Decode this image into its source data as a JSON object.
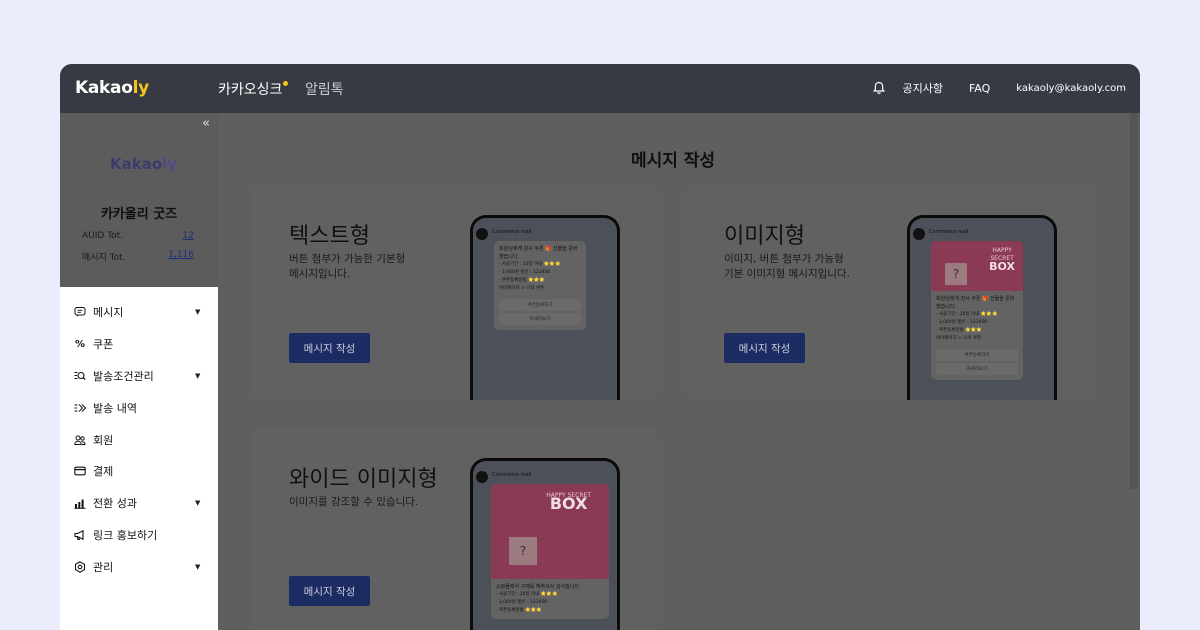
{
  "topbar": {
    "logo_main": "Kakao",
    "logo_accent": "ly",
    "tabs": [
      "카카오싱크",
      "알림톡"
    ],
    "notice": "공지사항",
    "faq": "FAQ",
    "email": "kakaoly@kakaoly.com"
  },
  "sidebar": {
    "collapse_glyph": "«",
    "logo_a": "Kakao",
    "logo_b": "ly",
    "store_name": "카카올리 굿즈",
    "stats": [
      {
        "label": "AUID Tot.",
        "value": "12"
      },
      {
        "label": "메시지 Tot.",
        "value": "1,116"
      }
    ],
    "menu": [
      {
        "label": "메시지",
        "icon": "message-icon",
        "has_caret": true
      },
      {
        "label": "쿠폰",
        "icon": "percent-icon",
        "has_caret": false
      },
      {
        "label": "발송조건관리",
        "icon": "search-list-icon",
        "has_caret": true
      },
      {
        "label": "발송 내역",
        "icon": "send-history-icon",
        "has_caret": false
      },
      {
        "label": "회원",
        "icon": "users-icon",
        "has_caret": false
      },
      {
        "label": "결제",
        "icon": "card-icon",
        "has_caret": false
      },
      {
        "label": "전환 성과",
        "icon": "chart-icon",
        "has_caret": true
      },
      {
        "label": "링크 홍보하기",
        "icon": "megaphone-icon",
        "has_caret": false
      },
      {
        "label": "관리",
        "icon": "settings-icon",
        "has_caret": true
      }
    ]
  },
  "main": {
    "title": "메시지 작성",
    "cards": [
      {
        "title": "텍스트형",
        "desc_1": "버튼 첨부가 가능한 기본형",
        "desc_2": "메시지입니다.",
        "button": "메시지 작성"
      },
      {
        "title": "이미지형",
        "desc_1": "이미지, 버튼 첨부가 가능형",
        "desc_2": "기본 이미지형 메시지입니다.",
        "button": "메시지 작성"
      },
      {
        "title": "와이드 이미지형",
        "desc_1": "이미지를 강조할 수 있습니다.",
        "desc_2": "",
        "button": "메시지 작성"
      }
    ],
    "phone": {
      "label": "Commerce mall",
      "brand": "kakao",
      "text_intro": "회원님에게 감사 쿠폰 🎁 선물을 준비했습니다.",
      "line1": "· 사용기간 : 10일 이내 ⭐⭐⭐",
      "line2": "· 3,000원 할인 : 123456",
      "line3": "· 쿠폰등록방법 ⭐⭐⭐",
      "line4": "마이페이지 > 나의 쿠폰",
      "btn1": "쿠폰등록하기",
      "btn2": "자세히보기",
      "box_small": "HAPPY",
      "box_secret": "SECRET",
      "box_big": "BOX",
      "q": "?",
      "wide_intro": "쇼핑몰에서 구매를 해주셔서 감사합니다.",
      "wide_top": "HAPPY SECRET"
    }
  }
}
